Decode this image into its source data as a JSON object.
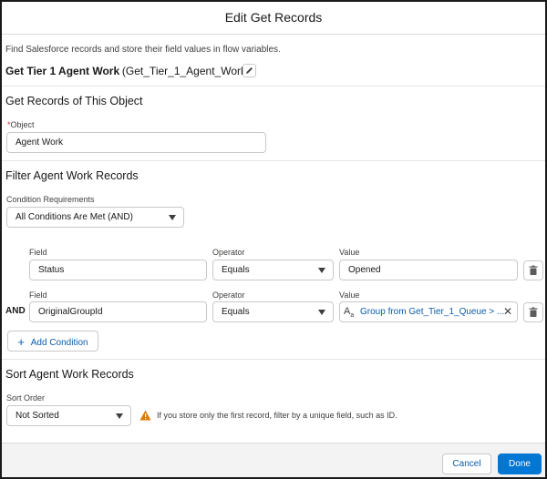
{
  "modal": {
    "title": "Edit Get Records",
    "description": "Find Salesforce records and store their field values in flow variables.",
    "element_label": "Get Tier 1 Agent Work",
    "element_api_name": "(Get_Tier_1_Agent_Work)"
  },
  "object_section": {
    "title": "Get Records of This Object",
    "object_label": "Object",
    "required_mark": "*",
    "object_value": "Agent Work"
  },
  "filter_section": {
    "title": "Filter Agent Work Records",
    "condition_label": "Condition Requirements",
    "condition_value": "All Conditions Are Met (AND)",
    "rows": [
      {
        "connector": "",
        "field_label": "Field",
        "field_value": "Status",
        "operator_label": "Operator",
        "operator_value": "Equals",
        "value_label": "Value",
        "value_value": "Opened"
      },
      {
        "connector": "AND",
        "field_label": "Field",
        "field_value": "OriginalGroupId",
        "operator_label": "Operator",
        "operator_value": "Equals",
        "value_label": "Value",
        "value_value": "Group from Get_Tier_1_Queue > ..."
      }
    ],
    "add_condition_label": "Add Condition"
  },
  "sort_section": {
    "title": "Sort Agent Work Records",
    "sort_order_label": "Sort Order",
    "sort_order_value": "Not Sorted",
    "warning_text": "If you store only the first record, filter by a unique field, such as ID."
  },
  "footer": {
    "cancel_label": "Cancel",
    "done_label": "Done"
  },
  "colors": {
    "brand": "#0176d3",
    "link": "#0b5cab",
    "warning": "#dd7a01"
  }
}
